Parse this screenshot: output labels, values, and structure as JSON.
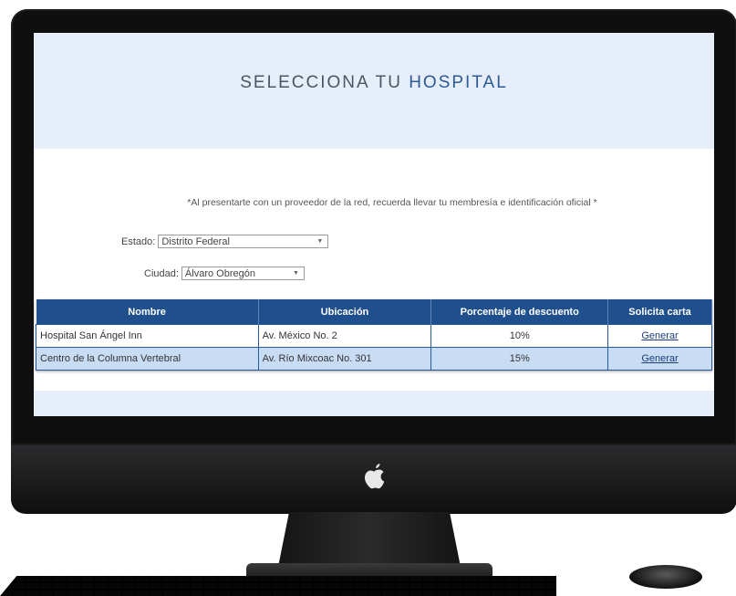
{
  "header": {
    "title_part1": "SELECCIONA TU ",
    "title_part2": "HOSPITAL"
  },
  "notice": "*Al presentarte con un proveedor de la red, recuerda llevar tu membresía e identificación oficial *",
  "form": {
    "estado_label": "Estado:",
    "estado_value": "Distrito Federal",
    "ciudad_label": "Ciudad:",
    "ciudad_value": "Álvaro Obregón"
  },
  "table": {
    "headers": [
      "Nombre",
      "Ubicación",
      "Porcentaje de descuento",
      "Solicita carta"
    ],
    "rows": [
      {
        "nombre": "Hospital San Ángel Inn",
        "ubicacion": "Av. México No. 2",
        "descuento": "10%",
        "accion": "Generar"
      },
      {
        "nombre": "Centro de la Columna Vertebral",
        "ubicacion": "Av. Río Mixcoac No. 301",
        "descuento": "15%",
        "accion": "Generar"
      }
    ]
  },
  "colors": {
    "header_bg": "#1f4f8c",
    "row_alt_bg": "#c8dcf4",
    "banner_bg": "#e6eefa",
    "title_accent": "#2d5a96"
  },
  "icons": {
    "brand": "apple-logo-icon",
    "dropdown": "chevron-down-icon"
  }
}
